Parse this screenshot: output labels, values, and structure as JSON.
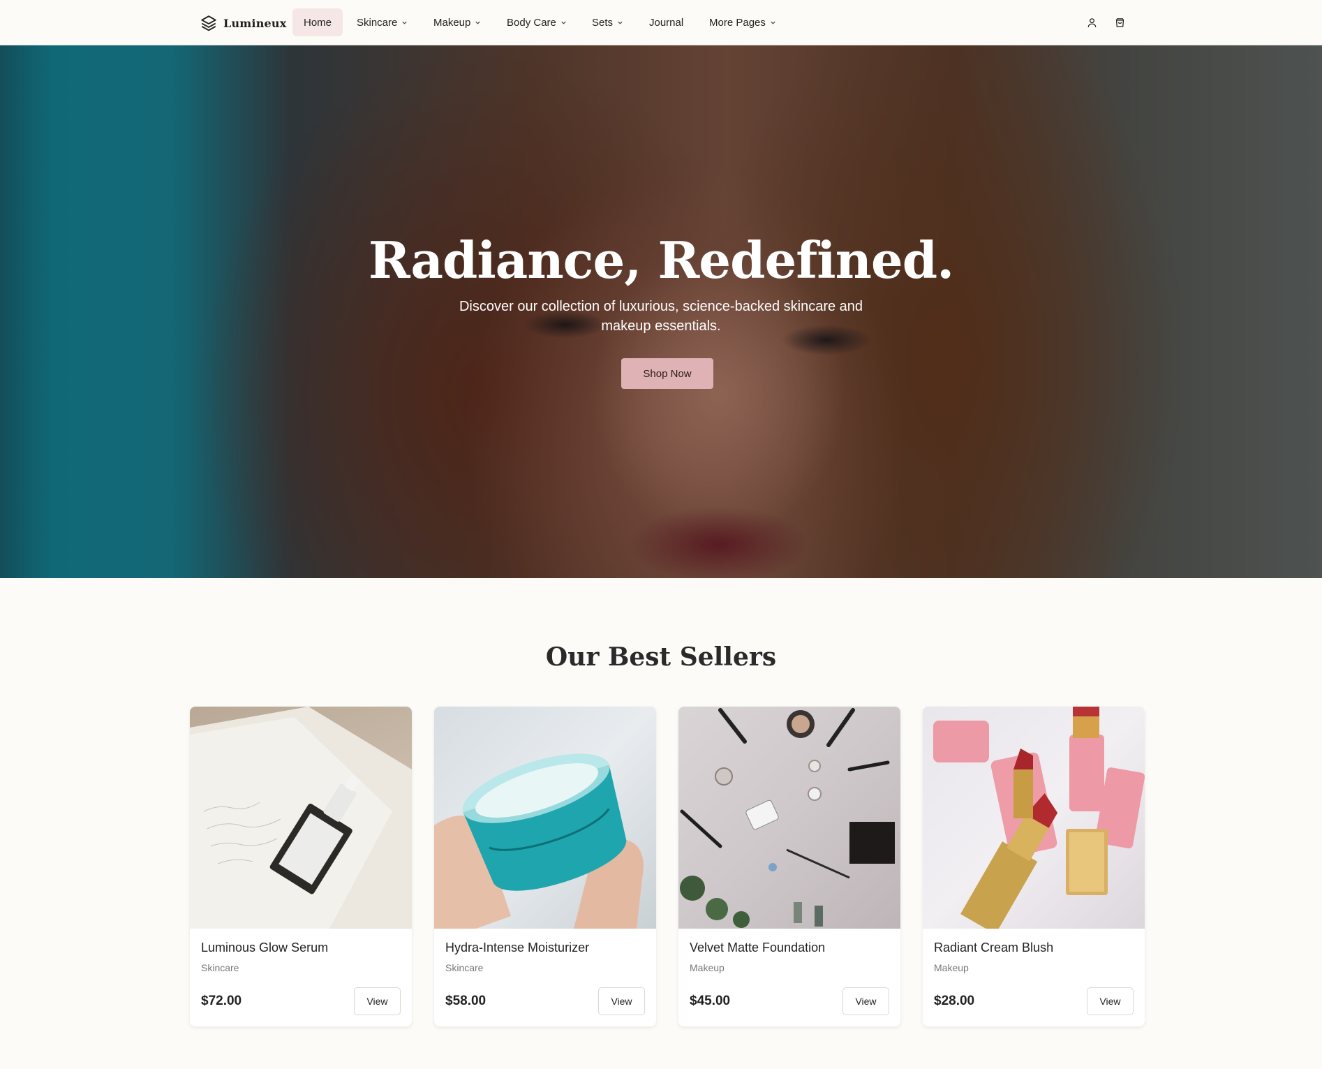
{
  "brand": {
    "name": "Lumineux"
  },
  "nav": {
    "items": [
      {
        "label": "Home",
        "active": true,
        "dropdown": false
      },
      {
        "label": "Skincare",
        "active": false,
        "dropdown": true
      },
      {
        "label": "Makeup",
        "active": false,
        "dropdown": true
      },
      {
        "label": "Body Care",
        "active": false,
        "dropdown": true
      },
      {
        "label": "Sets",
        "active": false,
        "dropdown": true
      },
      {
        "label": "Journal",
        "active": false,
        "dropdown": false
      },
      {
        "label": "More Pages",
        "active": false,
        "dropdown": true
      }
    ],
    "icons": [
      "user-icon",
      "cart-icon"
    ]
  },
  "hero": {
    "title": "Radiance, Redefined.",
    "subtitle": "Discover our collection of luxurious, science-backed skincare and makeup essentials.",
    "cta": "Shop Now"
  },
  "best_sellers": {
    "title": "Our Best Sellers",
    "products": [
      {
        "name": "Luminous Glow Serum",
        "category": "Skincare",
        "price": "$72.00",
        "action": "View"
      },
      {
        "name": "Hydra-Intense Moisturizer",
        "category": "Skincare",
        "price": "$58.00",
        "action": "View"
      },
      {
        "name": "Velvet Matte Foundation",
        "category": "Makeup",
        "price": "$45.00",
        "action": "View"
      },
      {
        "name": "Radiant Cream Blush",
        "category": "Makeup",
        "price": "$28.00",
        "action": "View"
      }
    ]
  },
  "colors": {
    "accent": "#dfb2b5",
    "active_nav_bg": "#f6e7e7",
    "page_bg": "#fcfbf7"
  }
}
